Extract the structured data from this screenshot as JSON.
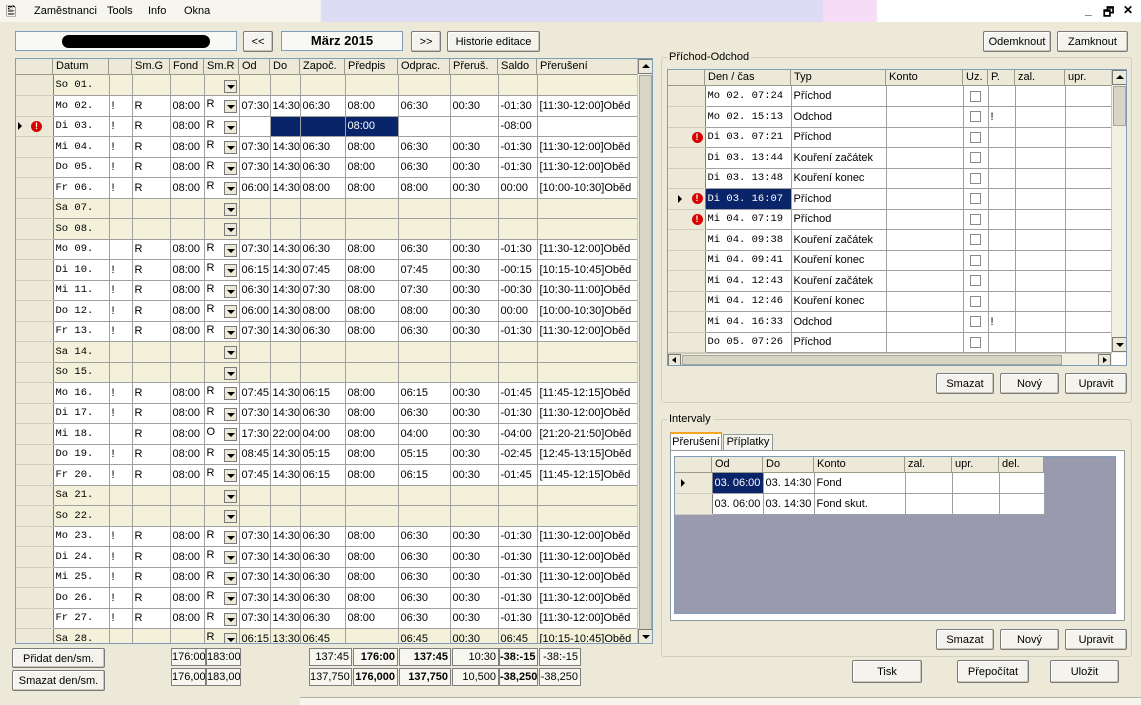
{
  "menu": {
    "items": [
      "Zaměstnanci",
      "Tools",
      "Info",
      "Okna"
    ],
    "win_min": "_",
    "win_restore": "🗗",
    "win_close": "✕"
  },
  "toolbar": {
    "prev": "<<",
    "month": "März 2015",
    "next": ">>",
    "history": "Historie editace",
    "unlock": "Odemknout",
    "lock": "Zamknout"
  },
  "days": {
    "columns": [
      "Datum",
      "",
      "Sm.G",
      "Fond",
      "Sm.R",
      "Od",
      "Do",
      "Započ.",
      "Předpis",
      "Odprac.",
      "Přeruš.",
      "Saldo",
      "Přerušení"
    ],
    "rows": [
      {
        "d": "So 01.",
        "f": "",
        "g": "",
        "fo": "",
        "r": "",
        "od": "",
        "do": "",
        "za": "",
        "pr": "",
        "op": "",
        "pe": "",
        "sa": "",
        "pu": "",
        "we": true
      },
      {
        "d": "Mo 02.",
        "f": "!",
        "g": "R",
        "fo": "08:00",
        "r": "R",
        "od": "07:30",
        "do": "14:30",
        "za": "06:30",
        "pr": "08:00",
        "op": "06:30",
        "pe": "00:30",
        "sa": "-01:30",
        "pu": "[11:30-12:00]Oběd"
      },
      {
        "d": "Di 03.",
        "f": "!",
        "g": "R",
        "fo": "08:00",
        "r": "R",
        "od": "",
        "do": "",
        "za": "",
        "pr": "08:00",
        "op": "",
        "pe": "",
        "sa": "-08:00",
        "pu": "",
        "cur": true,
        "err": true
      },
      {
        "d": "Mi 04.",
        "f": "!",
        "g": "R",
        "fo": "08:00",
        "r": "R",
        "od": "07:30",
        "do": "14:30",
        "za": "06:30",
        "pr": "08:00",
        "op": "06:30",
        "pe": "00:30",
        "sa": "-01:30",
        "pu": "[11:30-12:00]Oběd"
      },
      {
        "d": "Do 05.",
        "f": "!",
        "g": "R",
        "fo": "08:00",
        "r": "R",
        "od": "07:30",
        "do": "14:30",
        "za": "06:30",
        "pr": "08:00",
        "op": "06:30",
        "pe": "00:30",
        "sa": "-01:30",
        "pu": "[11:30-12:00]Oběd"
      },
      {
        "d": "Fr 06.",
        "f": "!",
        "g": "R",
        "fo": "08:00",
        "r": "R",
        "od": "06:00",
        "do": "14:30",
        "za": "08:00",
        "pr": "08:00",
        "op": "08:00",
        "pe": "00:30",
        "sa": "00:00",
        "pu": "[10:00-10:30]Oběd"
      },
      {
        "d": "Sa 07.",
        "f": "",
        "g": "",
        "fo": "",
        "r": "",
        "od": "",
        "do": "",
        "za": "",
        "pr": "",
        "op": "",
        "pe": "",
        "sa": "",
        "pu": "",
        "we": true
      },
      {
        "d": "So 08.",
        "f": "",
        "g": "",
        "fo": "",
        "r": "",
        "od": "",
        "do": "",
        "za": "",
        "pr": "",
        "op": "",
        "pe": "",
        "sa": "",
        "pu": "",
        "we": true
      },
      {
        "d": "Mo 09.",
        "f": "",
        "g": "R",
        "fo": "08:00",
        "r": "R",
        "od": "07:30",
        "do": "14:30",
        "za": "06:30",
        "pr": "08:00",
        "op": "06:30",
        "pe": "00:30",
        "sa": "-01:30",
        "pu": "[11:30-12:00]Oběd"
      },
      {
        "d": "Di 10.",
        "f": "!",
        "g": "R",
        "fo": "08:00",
        "r": "R",
        "od": "06:15",
        "do": "14:30",
        "za": "07:45",
        "pr": "08:00",
        "op": "07:45",
        "pe": "00:30",
        "sa": "-00:15",
        "pu": "[10:15-10:45]Oběd"
      },
      {
        "d": "Mi 11.",
        "f": "!",
        "g": "R",
        "fo": "08:00",
        "r": "R",
        "od": "06:30",
        "do": "14:30",
        "za": "07:30",
        "pr": "08:00",
        "op": "07:30",
        "pe": "00:30",
        "sa": "-00:30",
        "pu": "[10:30-11:00]Oběd"
      },
      {
        "d": "Do 12.",
        "f": "!",
        "g": "R",
        "fo": "08:00",
        "r": "R",
        "od": "06:00",
        "do": "14:30",
        "za": "08:00",
        "pr": "08:00",
        "op": "08:00",
        "pe": "00:30",
        "sa": "00:00",
        "pu": "[10:00-10:30]Oběd"
      },
      {
        "d": "Fr 13.",
        "f": "!",
        "g": "R",
        "fo": "08:00",
        "r": "R",
        "od": "07:30",
        "do": "14:30",
        "za": "06:30",
        "pr": "08:00",
        "op": "06:30",
        "pe": "00:30",
        "sa": "-01:30",
        "pu": "[11:30-12:00]Oběd"
      },
      {
        "d": "Sa 14.",
        "f": "",
        "g": "",
        "fo": "",
        "r": "",
        "od": "",
        "do": "",
        "za": "",
        "pr": "",
        "op": "",
        "pe": "",
        "sa": "",
        "pu": "",
        "we": true
      },
      {
        "d": "So 15.",
        "f": "",
        "g": "",
        "fo": "",
        "r": "",
        "od": "",
        "do": "",
        "za": "",
        "pr": "",
        "op": "",
        "pe": "",
        "sa": "",
        "pu": "",
        "we": true
      },
      {
        "d": "Mo 16.",
        "f": "!",
        "g": "R",
        "fo": "08:00",
        "r": "R",
        "od": "07:45",
        "do": "14:30",
        "za": "06:15",
        "pr": "08:00",
        "op": "06:15",
        "pe": "00:30",
        "sa": "-01:45",
        "pu": "[11:45-12:15]Oběd"
      },
      {
        "d": "Di 17.",
        "f": "!",
        "g": "R",
        "fo": "08:00",
        "r": "R",
        "od": "07:30",
        "do": "14:30",
        "za": "06:30",
        "pr": "08:00",
        "op": "06:30",
        "pe": "00:30",
        "sa": "-01:30",
        "pu": "[11:30-12:00]Oběd"
      },
      {
        "d": "Mi 18.",
        "f": "",
        "g": "R",
        "fo": "08:00",
        "r": "O",
        "od": "17:30",
        "do": "22:00",
        "za": "04:00",
        "pr": "08:00",
        "op": "04:00",
        "pe": "00:30",
        "sa": "-04:00",
        "pu": "[21:20-21:50]Oběd"
      },
      {
        "d": "Do 19.",
        "f": "!",
        "g": "R",
        "fo": "08:00",
        "r": "R",
        "od": "08:45",
        "do": "14:30",
        "za": "05:15",
        "pr": "08:00",
        "op": "05:15",
        "pe": "00:30",
        "sa": "-02:45",
        "pu": "[12:45-13:15]Oběd"
      },
      {
        "d": "Fr 20.",
        "f": "!",
        "g": "R",
        "fo": "08:00",
        "r": "R",
        "od": "07:45",
        "do": "14:30",
        "za": "06:15",
        "pr": "08:00",
        "op": "06:15",
        "pe": "00:30",
        "sa": "-01:45",
        "pu": "[11:45-12:15]Oběd"
      },
      {
        "d": "Sa 21.",
        "f": "",
        "g": "",
        "fo": "",
        "r": "",
        "od": "",
        "do": "",
        "za": "",
        "pr": "",
        "op": "",
        "pe": "",
        "sa": "",
        "pu": "",
        "we": true
      },
      {
        "d": "So 22.",
        "f": "",
        "g": "",
        "fo": "",
        "r": "",
        "od": "",
        "do": "",
        "za": "",
        "pr": "",
        "op": "",
        "pe": "",
        "sa": "",
        "pu": "",
        "we": true
      },
      {
        "d": "Mo 23.",
        "f": "!",
        "g": "R",
        "fo": "08:00",
        "r": "R",
        "od": "07:30",
        "do": "14:30",
        "za": "06:30",
        "pr": "08:00",
        "op": "06:30",
        "pe": "00:30",
        "sa": "-01:30",
        "pu": "[11:30-12:00]Oběd"
      },
      {
        "d": "Di 24.",
        "f": "!",
        "g": "R",
        "fo": "08:00",
        "r": "R",
        "od": "07:30",
        "do": "14:30",
        "za": "06:30",
        "pr": "08:00",
        "op": "06:30",
        "pe": "00:30",
        "sa": "-01:30",
        "pu": "[11:30-12:00]Oběd"
      },
      {
        "d": "Mi 25.",
        "f": "!",
        "g": "R",
        "fo": "08:00",
        "r": "R",
        "od": "07:30",
        "do": "14:30",
        "za": "06:30",
        "pr": "08:00",
        "op": "06:30",
        "pe": "00:30",
        "sa": "-01:30",
        "pu": "[11:30-12:00]Oběd"
      },
      {
        "d": "Do 26.",
        "f": "!",
        "g": "R",
        "fo": "08:00",
        "r": "R",
        "od": "07:30",
        "do": "14:30",
        "za": "06:30",
        "pr": "08:00",
        "op": "06:30",
        "pe": "00:30",
        "sa": "-01:30",
        "pu": "[11:30-12:00]Oběd"
      },
      {
        "d": "Fr 27.",
        "f": "!",
        "g": "R",
        "fo": "08:00",
        "r": "R",
        "od": "07:30",
        "do": "14:30",
        "za": "06:30",
        "pr": "08:00",
        "op": "06:30",
        "pe": "00:30",
        "sa": "-01:30",
        "pu": "[11:30-12:00]Oběd"
      },
      {
        "d": "Sa 28.",
        "f": "",
        "g": "",
        "fo": "",
        "r": "R",
        "od": "06:15",
        "do": "13:30",
        "za": "06:45",
        "pr": "",
        "op": "06:45",
        "pe": "00:30",
        "sa": "06:45",
        "pu": "[10:15-10:45]Oběd",
        "we": true
      }
    ]
  },
  "totals": {
    "row1": [
      "176:00",
      "183:00",
      "137:45",
      "176:00",
      "137:45",
      "10:30",
      "-38:-15",
      "-38:-15"
    ],
    "row2": [
      "176,00",
      "183,00",
      "137,750",
      "176,000",
      "137,750",
      "10,500",
      "-38,250",
      "-38,250"
    ]
  },
  "left_buttons": {
    "add": "Přidat den/sm.",
    "delete": "Smazat den/sm."
  },
  "prichod": {
    "title": "Příchod-Odchod",
    "columns": [
      "Den / čas",
      "Typ",
      "Konto",
      "Uz.",
      "P.",
      "zal.",
      "upr."
    ],
    "rows": [
      {
        "t": "Mo 02. 07:24",
        "ty": "Příchod",
        "p": ""
      },
      {
        "t": "Mo 02. 15:13",
        "ty": "Odchod",
        "p": "!"
      },
      {
        "t": "Di 03. 07:21",
        "ty": "Příchod",
        "p": "",
        "err": true
      },
      {
        "t": "Di 03. 13:44",
        "ty": "Kouření začátek",
        "p": ""
      },
      {
        "t": "Di 03. 13:48",
        "ty": "Kouření konec",
        "p": ""
      },
      {
        "t": "Di 03. 16:07",
        "ty": "Příchod",
        "p": "",
        "err": true,
        "sel": true
      },
      {
        "t": "Mi 04. 07:19",
        "ty": "Příchod",
        "p": "",
        "err": true
      },
      {
        "t": "Mi 04. 09:38",
        "ty": "Kouření začátek",
        "p": ""
      },
      {
        "t": "Mi 04. 09:41",
        "ty": "Kouření konec",
        "p": ""
      },
      {
        "t": "Mi 04. 12:43",
        "ty": "Kouření začátek",
        "p": ""
      },
      {
        "t": "Mi 04. 12:46",
        "ty": "Kouření konec",
        "p": ""
      },
      {
        "t": "Mi 04. 16:33",
        "ty": "Odchod",
        "p": "!"
      },
      {
        "t": "Do 05. 07:26",
        "ty": "Příchod",
        "p": ""
      }
    ],
    "buttons": {
      "delete": "Smazat",
      "new": "Nový",
      "edit": "Upravit"
    }
  },
  "intervaly": {
    "title": "Intervaly",
    "tabs": [
      "Přerušení",
      "Příplatky"
    ],
    "columns": [
      "Od",
      "Do",
      "Konto",
      "zal.",
      "upr.",
      "del."
    ],
    "rows": [
      {
        "od": "03. 06:00",
        "do": "03. 14:30",
        "k": "Fond",
        "sel": true
      },
      {
        "od": "03. 06:00",
        "do": "03. 14:30",
        "k": "Fond skut."
      }
    ],
    "buttons": {
      "delete": "Smazat",
      "new": "Nový",
      "edit": "Upravit"
    }
  },
  "bottom_buttons": {
    "print": "Tisk",
    "recalc": "Přepočítat",
    "save": "Uložit"
  }
}
